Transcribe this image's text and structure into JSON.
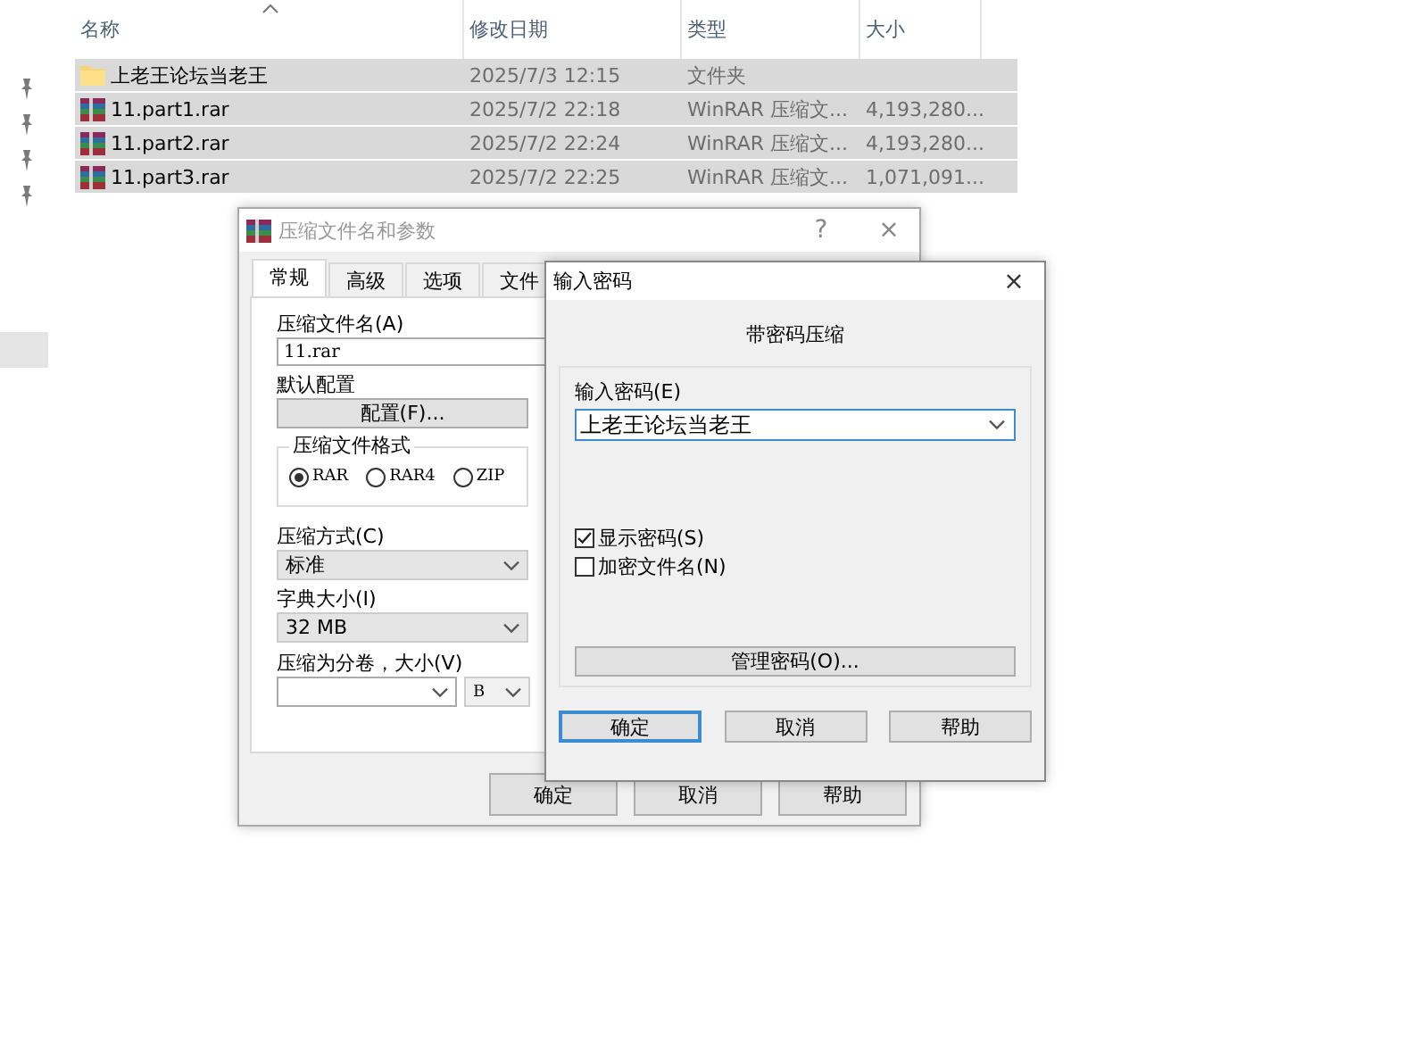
{
  "explorer": {
    "columns": [
      {
        "label": "名称",
        "sorted": true
      },
      {
        "label": "修改日期",
        "sorted": false
      },
      {
        "label": "类型",
        "sorted": false
      },
      {
        "label": "大小",
        "sorted": false
      }
    ],
    "rows": [
      {
        "kind": "folder",
        "name": "上老王论坛当老王",
        "date": "2025/7/3 12:15",
        "type": "文件夹",
        "selected": true
      },
      {
        "kind": "archive",
        "name": "11.part1.rar",
        "date": "2025/7/2 22:18",
        "type": "WinRAR 压缩文...",
        "size": "4,193,280...",
        "selected": true
      },
      {
        "kind": "archive",
        "name": "11.part2.rar",
        "date": "2025/7/2 22:24",
        "type": "WinRAR 压缩文...",
        "size": "4,193,280...",
        "selected": true
      },
      {
        "kind": "archive",
        "name": "11.part3.rar",
        "date": "2025/7/2 22:25",
        "type": "WinRAR 压缩文...",
        "size": "1,071,091...",
        "selected": true
      }
    ]
  },
  "archive_dialog": {
    "title": "压缩文件名和参数",
    "help": "?",
    "close": "×",
    "tabs": [
      {
        "label": "常规",
        "selected": true
      },
      {
        "label": "高级",
        "selected": false
      },
      {
        "label": "选项",
        "selected": false
      },
      {
        "label": "文件",
        "selected": false
      }
    ],
    "archive_name_label": "压缩文件名(A)",
    "archive_name": "11.rar",
    "profile_label": "默认配置",
    "profile_button": "配置(F)...",
    "format_group": "压缩文件格式",
    "formats": [
      {
        "label": "RAR",
        "selected": true
      },
      {
        "label": "RAR4",
        "selected": false
      },
      {
        "label": "ZIP",
        "selected": false
      }
    ],
    "method_label": "压缩方式(C)",
    "method": "标准",
    "dictionary_label": "字典大小(I)",
    "dictionary": "32 MB",
    "volume_label": "压缩为分卷，大小(V)",
    "volume_unit": "B",
    "buttons": [
      "确定",
      "取消",
      "帮助"
    ]
  },
  "password_dialog": {
    "title": "输入密码",
    "close": "×",
    "heading": "带密码压缩",
    "password_label": "输入密码(E)",
    "password": "上老王论坛当老王",
    "options": [
      {
        "label": "显示密码(S)",
        "checked": true
      },
      {
        "label": "加密文件名(N)",
        "checked": false
      }
    ],
    "manage_button": "管理密码(O)...",
    "buttons": [
      {
        "label": "确定",
        "default": true
      },
      {
        "label": "取消",
        "default": false
      },
      {
        "label": "帮助",
        "default": false
      }
    ]
  }
}
